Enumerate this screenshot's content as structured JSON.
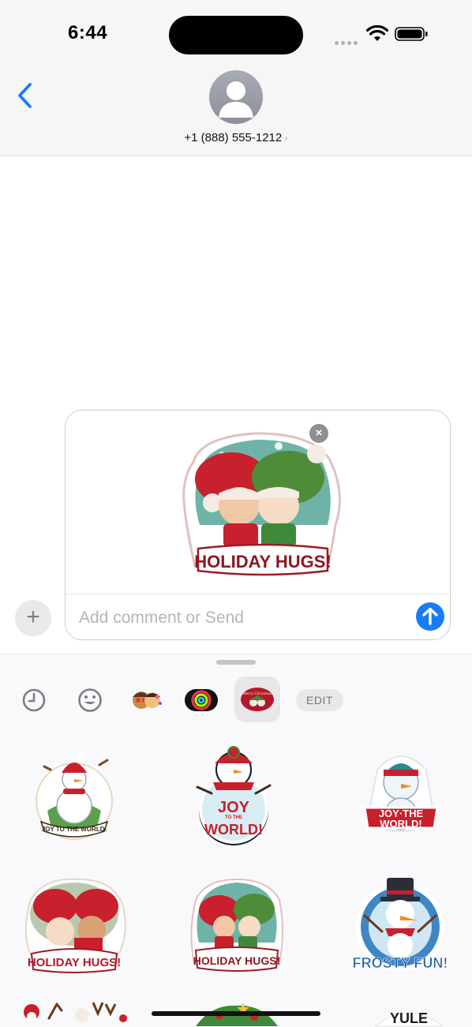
{
  "status_bar": {
    "time": "6:44"
  },
  "header": {
    "contact": "+1 (888) 555-1212",
    "contact_chevron": "›"
  },
  "compose": {
    "remove_glyph": "×",
    "plus_glyph": "+",
    "comment_placeholder": "Add comment or Send",
    "comment_value": "",
    "attached_sticker": {
      "caption": "HOLIDAY HUGS!",
      "icon": "holiday-hugs-sticker"
    }
  },
  "drawer": {
    "tabs": [
      {
        "name": "recents",
        "icon": "clock-icon"
      },
      {
        "name": "emoji",
        "icon": "smiley-icon"
      },
      {
        "name": "memoji",
        "icon": "memoji-sticker-icon"
      },
      {
        "name": "activity",
        "icon": "activity-rings-icon"
      },
      {
        "name": "christmas-pack",
        "icon": "merry-christmas-pack-icon",
        "label": "Merry Christmas",
        "active": true
      }
    ],
    "edit_label": "EDIT",
    "stickers": [
      {
        "caption": "JOY TO THE WORLD!",
        "icon": "snowman-joy-sticker"
      },
      {
        "caption_top": "JOY",
        "caption_mid": "TO THE",
        "caption_bottom": "WORLD!",
        "icon": "snowman-joy-round-sticker"
      },
      {
        "caption_top": "JOY·THE",
        "caption_bottom": "WORLD!",
        "icon": "snowman-banner-sticker"
      },
      {
        "caption": "HOLIDAY HUGS!",
        "icon": "holiday-hugs-sticker-alt"
      },
      {
        "caption": "HOLIDAY HUGS!",
        "icon": "holiday-hugs-sticker"
      },
      {
        "caption": "FROSTY FUN!",
        "icon": "frosty-fun-sticker"
      },
      {
        "caption": "",
        "icon": "santa-reindeer-sticker"
      },
      {
        "caption": "",
        "icon": "wreath-sticker"
      },
      {
        "caption": "YULE",
        "icon": "yule-sticker"
      }
    ]
  },
  "colors": {
    "accent": "#1a7cf5",
    "sticker_red": "#c8202c",
    "sticker_green": "#3f8a3a"
  }
}
